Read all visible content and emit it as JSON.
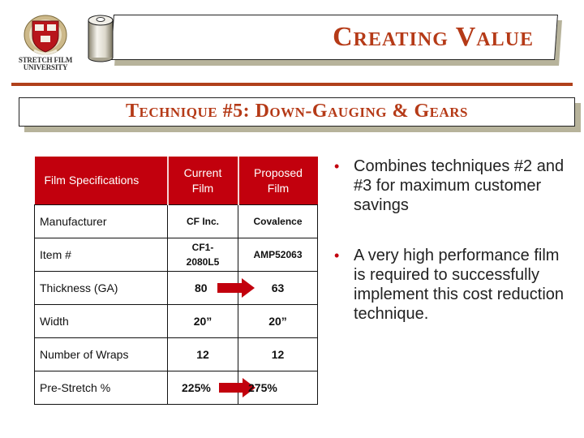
{
  "logo": {
    "name": "Stretch Film University",
    "line1": "Stretch Film",
    "line2": "University",
    "icon": "university-crest-icon"
  },
  "header": {
    "title": "Creating Value",
    "icon": "film-roll-icon",
    "subtitle": "Technique #5:  Down-Gauging & Gears"
  },
  "colors": {
    "accent_red": "#c2000d",
    "title_rust": "#b53a17",
    "rule_rust": "#b0401b",
    "shadow_tan": "#b7b39b"
  },
  "table": {
    "headers": [
      "Film Specifications",
      "Current Film",
      "Proposed Film"
    ],
    "rows": [
      {
        "label": "Manufacturer",
        "current": "CF Inc.",
        "proposed": "Covalence",
        "arrow": false
      },
      {
        "label": "Item #",
        "current": "CF1-\n2080L5",
        "proposed": "AMP52063",
        "arrow": false
      },
      {
        "label": "Thickness (GA)",
        "current": "80",
        "proposed": "63",
        "arrow": true
      },
      {
        "label": "Width",
        "current": "20”",
        "proposed": "20”",
        "arrow": false
      },
      {
        "label": "Number of Wraps",
        "current": "12",
        "proposed": "12",
        "arrow": false
      },
      {
        "label": "Pre-Stretch %",
        "current": "225%",
        "proposed": "275%",
        "arrow": true
      }
    ]
  },
  "bullets": [
    "Combines techniques #2 and #3 for maximum customer savings",
    "A very high performance film is required to successfully implement this cost reduction technique."
  ]
}
